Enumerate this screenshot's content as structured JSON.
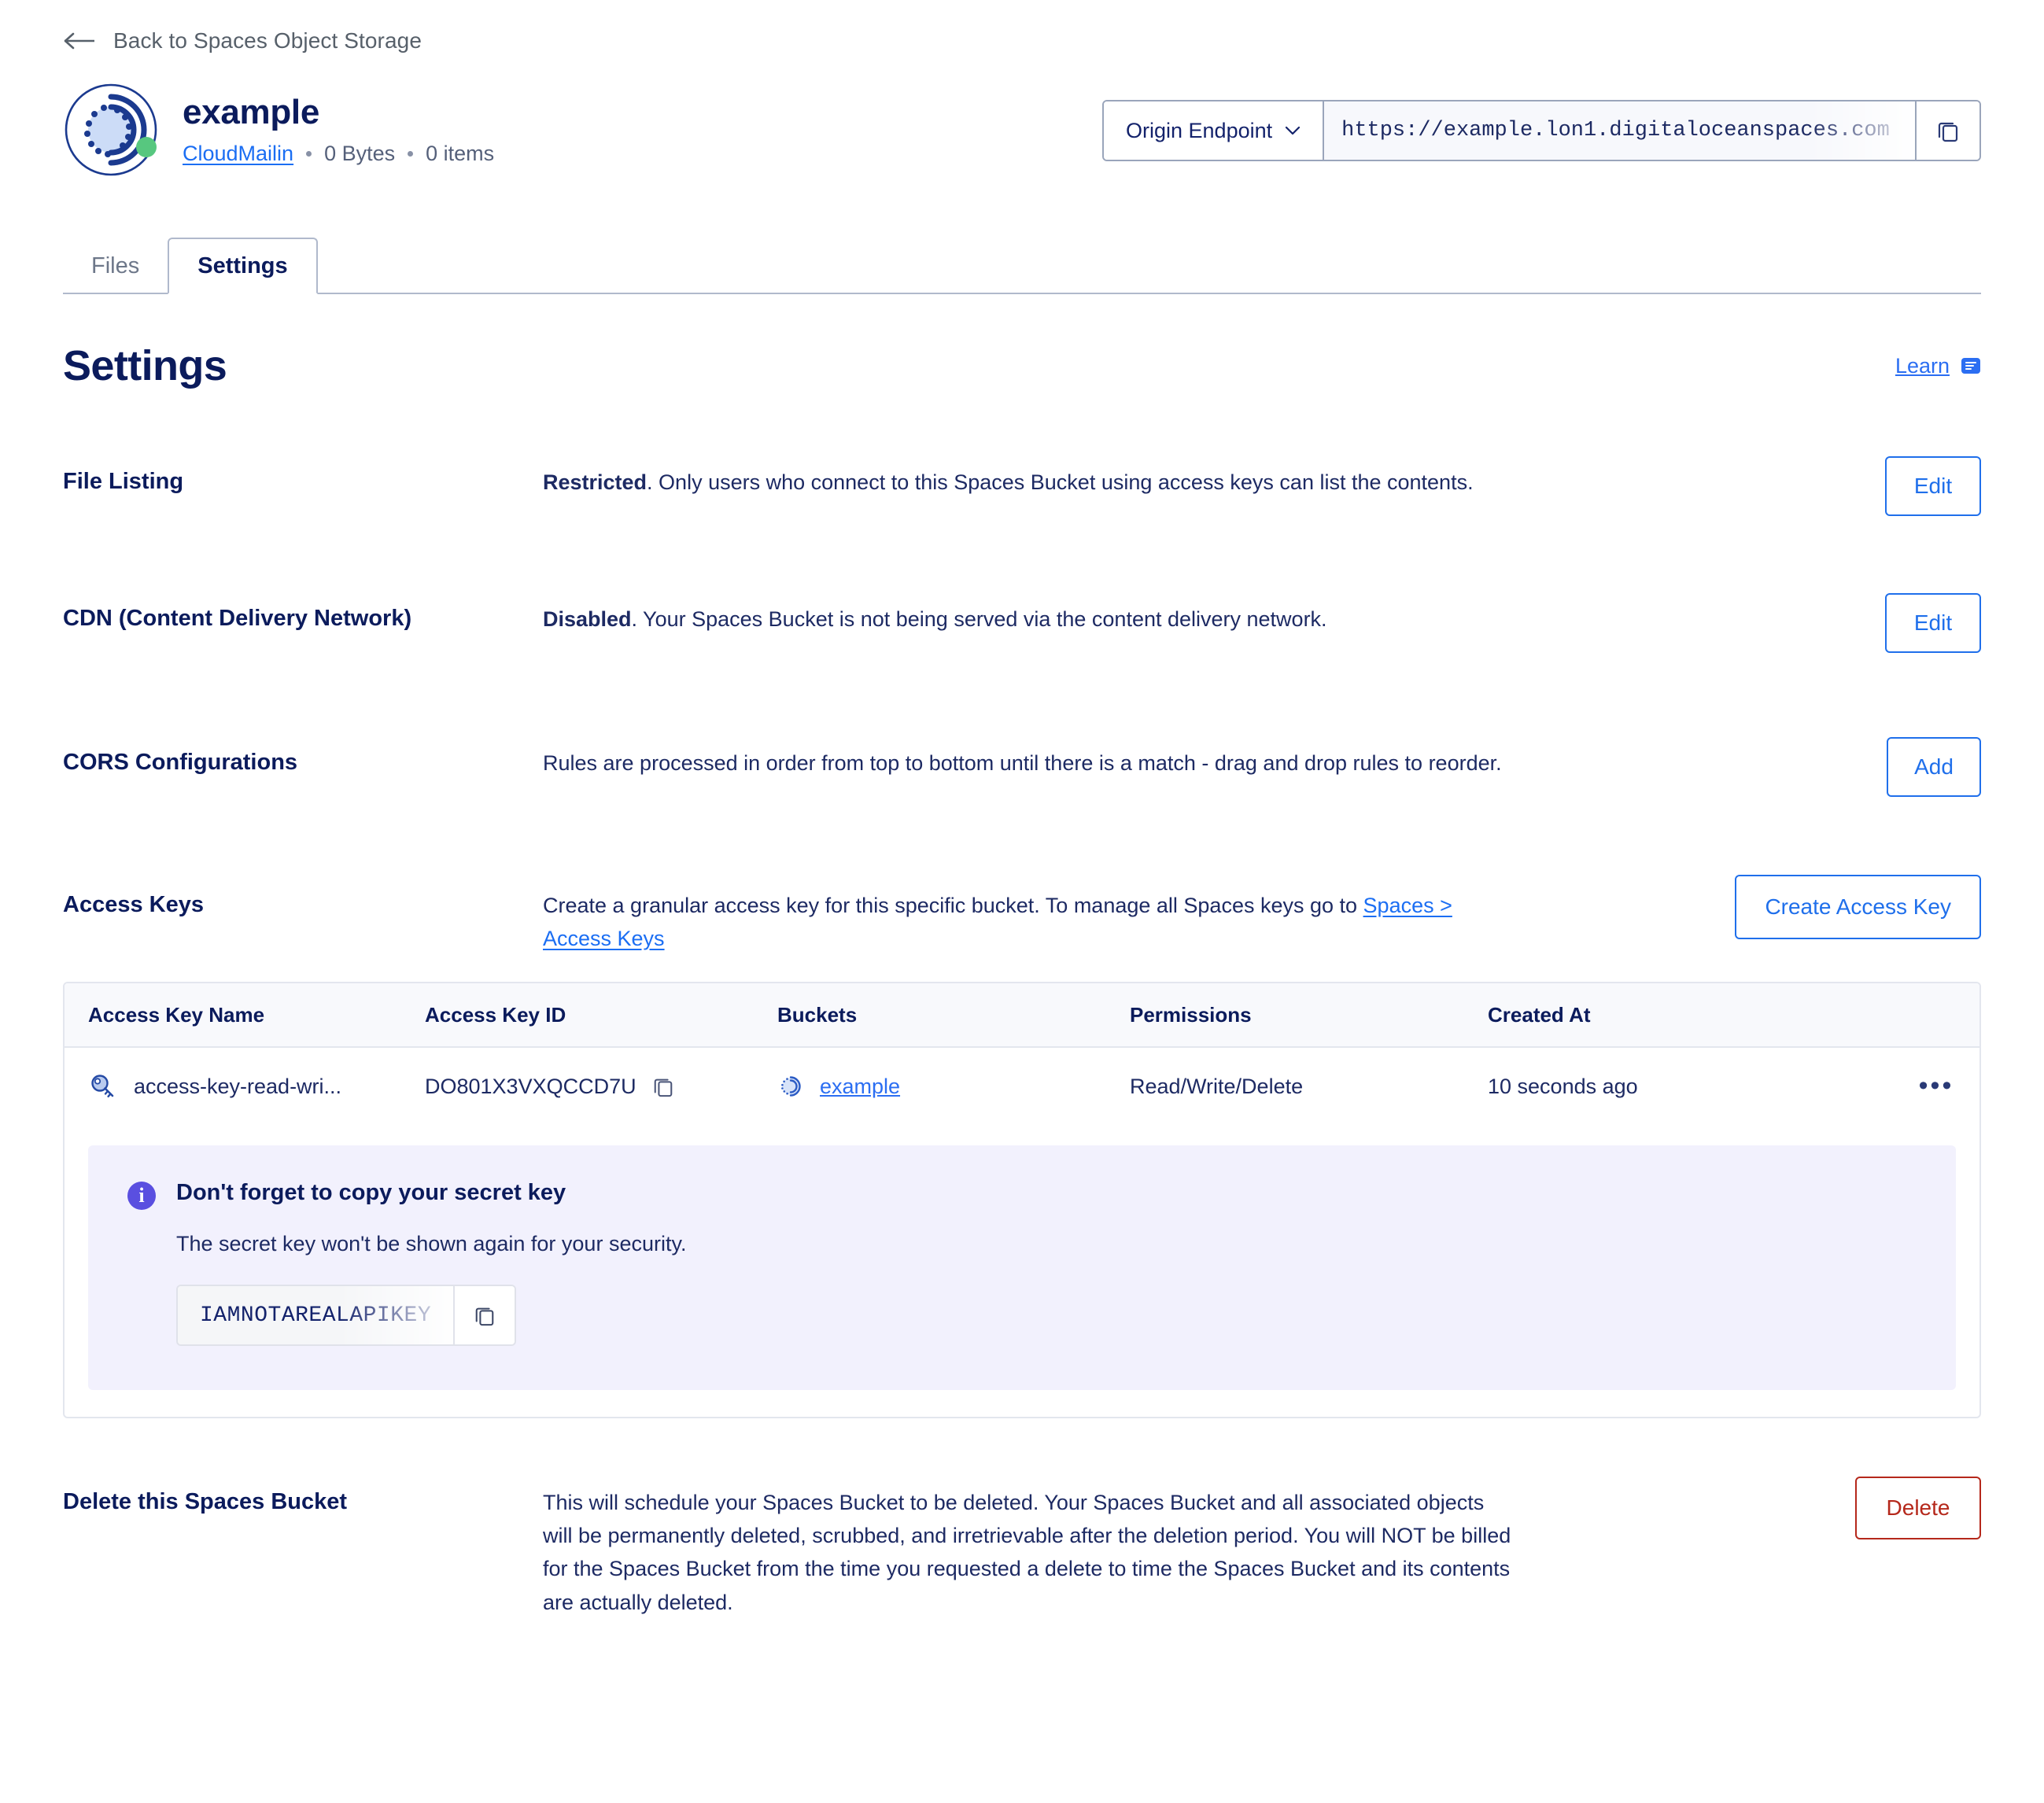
{
  "back": {
    "label": "Back to Spaces Object Storage",
    "icon": "arrow-left-icon"
  },
  "bucket": {
    "name": "example",
    "owner": "CloudMailin",
    "size": "0 Bytes",
    "items": "0 items",
    "status_color": "#57c77f"
  },
  "endpoint": {
    "select_label": "Origin Endpoint",
    "url": "https://example.lon1.digitaloceanspaces.com",
    "copy_icon": "copy-icon"
  },
  "tabs": [
    {
      "label": "Files",
      "active": false
    },
    {
      "label": "Settings",
      "active": true
    }
  ],
  "page": {
    "title": "Settings",
    "learn_label": "Learn",
    "learn_icon": "article-icon"
  },
  "settings_rows": [
    {
      "label": "File Listing",
      "desc_bold": "Restricted",
      "desc": ". Only users who connect to this Spaces Bucket using access keys can list the contents.",
      "action": "Edit"
    },
    {
      "label": "CDN (Content Delivery Network)",
      "desc_bold": "Disabled",
      "desc": ". Your Spaces Bucket is not being served via the content delivery network.",
      "action": "Edit"
    },
    {
      "label": "CORS Configurations",
      "desc": "Rules are processed in order from top to bottom until there is a match - drag and drop rules to reorder.",
      "action": "Add"
    }
  ],
  "access_keys": {
    "label": "Access Keys",
    "desc_part1": "Create a granular access key for this specific bucket. To manage all Spaces keys go to ",
    "desc_link": "Spaces > Access Keys",
    "create_button": "Create Access Key",
    "columns": [
      "Access Key Name",
      "Access Key ID",
      "Buckets",
      "Permissions",
      "Created At"
    ],
    "rows": [
      {
        "name": "access-key-read-wri...",
        "id": "DO801X3VXQCCD7U",
        "bucket": "example",
        "permissions": "Read/Write/Delete",
        "created_at": "10 seconds ago",
        "menu_icon": "kebab-menu-icon",
        "key_icon": "key-icon",
        "bucket_icon": "spaces-bucket-icon",
        "copy_icon": "copy-icon"
      }
    ],
    "notice": {
      "icon": "info-icon",
      "title": "Don't forget to copy your secret key",
      "subtitle": "The secret key won't be shown again for your security.",
      "secret_value": "IAMNOTAREALAPIKEY",
      "copy_icon": "copy-icon",
      "accent": "#5a4fe0",
      "background": "#f2f1fd"
    }
  },
  "delete_section": {
    "label": "Delete this Spaces Bucket",
    "desc": "This will schedule your Spaces Bucket to be deleted. Your Spaces Bucket and all associated objects will be permanently deleted, scrubbed, and irretrievable after the deletion period. You will NOT be billed for the Spaces Bucket from the time you requested a delete to time the Spaces Bucket and its contents are actually deleted.",
    "button": "Delete",
    "button_color": "#b5281b"
  }
}
